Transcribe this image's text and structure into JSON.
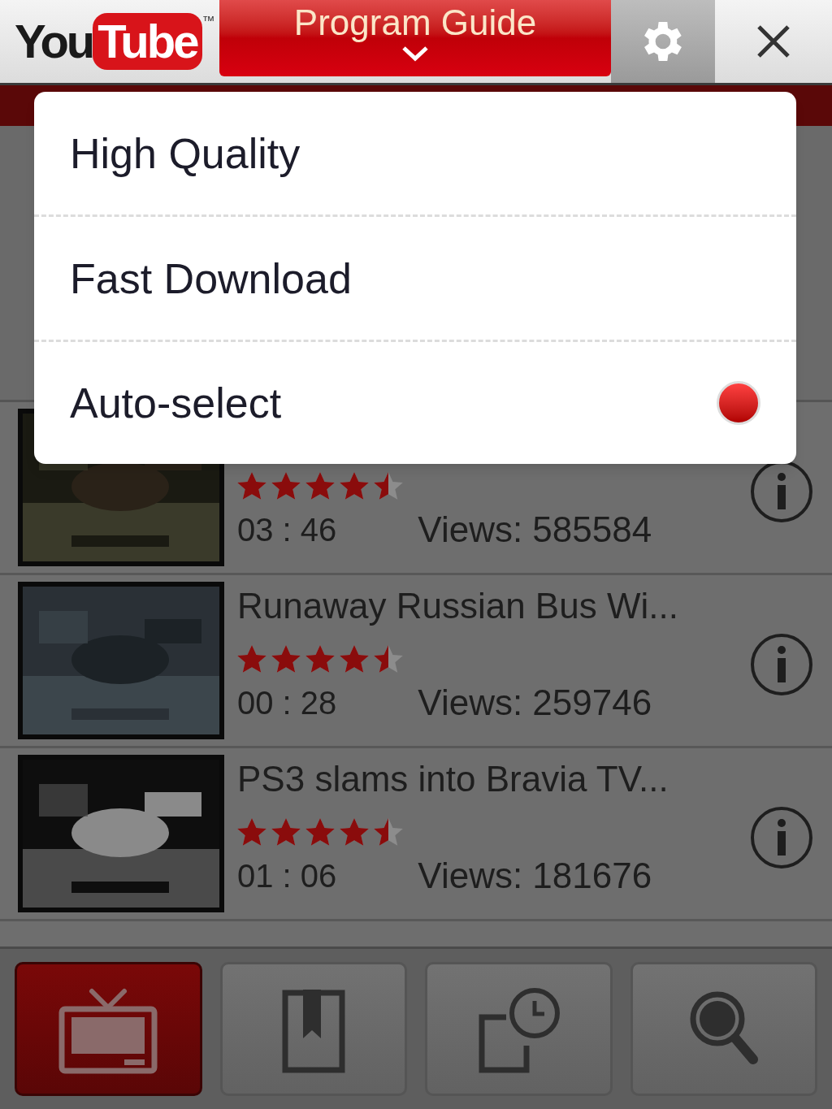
{
  "header": {
    "logo": {
      "you": "You",
      "tube": "Tube",
      "tm": "™"
    },
    "title": "Program Guide"
  },
  "quality_menu": [
    {
      "label": "High Quality",
      "selected": false
    },
    {
      "label": "Fast Download",
      "selected": false
    },
    {
      "label": "Auto-select",
      "selected": true
    }
  ],
  "videos": [
    {
      "stars": 4.5,
      "duration": "03 : 46",
      "views": "Views: 585584"
    },
    {
      "title": "Runaway Russian Bus Wi...",
      "stars": 4.5,
      "duration": "00 : 28",
      "views": "Views: 259746"
    },
    {
      "title": "PS3 slams into Bravia TV...",
      "stars": 4.5,
      "duration": "01 : 06",
      "views": "Views: 181676"
    }
  ],
  "tab_bar": [
    {
      "kind": "tv",
      "selected": true
    },
    {
      "kind": "bookmarks",
      "selected": false
    },
    {
      "kind": "history",
      "selected": false
    },
    {
      "kind": "search",
      "selected": false
    }
  ]
}
